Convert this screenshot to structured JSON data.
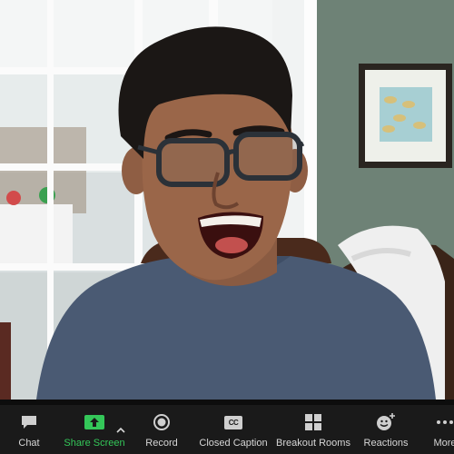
{
  "toolbar": {
    "items": [
      {
        "label": "Chat",
        "icon": "chat-icon"
      },
      {
        "label": "Share Screen",
        "icon": "share-screen-icon"
      },
      {
        "label": "Record",
        "icon": "record-icon"
      },
      {
        "label": "Closed Caption",
        "icon": "closed-caption-icon"
      },
      {
        "label": "Breakout Rooms",
        "icon": "breakout-rooms-icon"
      },
      {
        "label": "Reactions",
        "icon": "reactions-icon"
      },
      {
        "label": "More",
        "icon": "more-icon"
      }
    ],
    "cc_glyph": "CC"
  },
  "colors": {
    "toolbar_bg": "#1a1a1a",
    "accent_green": "#34c759",
    "label": "#d7d7d7"
  }
}
